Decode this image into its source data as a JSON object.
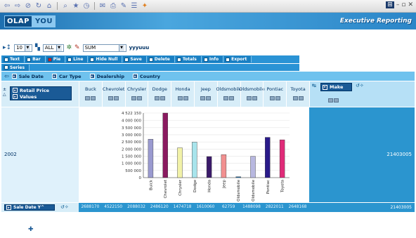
{
  "app": {
    "logo_left": "OLAP",
    "logo_right": "YOU",
    "header_title": "Executive Reporting"
  },
  "controls": {
    "topn_value": "10",
    "filter_value": "ALL",
    "function_value": "SUM",
    "period_label": "yyyuuu"
  },
  "toolbar": [
    {
      "label": "Text",
      "color": "white"
    },
    {
      "label": "Bar",
      "color": "white"
    },
    {
      "label": "Pie",
      "color": "red"
    },
    {
      "label": "Line",
      "color": "white"
    },
    {
      "label": "Hide Null",
      "color": "white"
    },
    {
      "label": "Save",
      "color": "white"
    },
    {
      "label": "Delete",
      "color": "white"
    },
    {
      "label": "Totals",
      "color": "white"
    },
    {
      "label": "Info",
      "color": "white"
    },
    {
      "label": "Export",
      "color": "white"
    }
  ],
  "series_label": "Series",
  "filters": [
    "Sale Date",
    "Car Type",
    "Dealership",
    "Country"
  ],
  "measures": [
    "Retail Price",
    "Values"
  ],
  "columns": [
    "Buck",
    "Chevrolet",
    "Chrysler",
    "Dodge",
    "Honda",
    "Jeep",
    "Oldsmobile",
    "Oldsmobile",
    "Pontiac",
    "Toyota"
  ],
  "make_label": "Make",
  "row_label": "2002",
  "row_total": "21403005",
  "footer_label": "Sale Date Y^",
  "footer_values": [
    "2688170",
    "4522150",
    "2088032",
    "2486120",
    "1474718",
    "1610060",
    "62759",
    "1488098",
    "2822011",
    "2648168"
  ],
  "footer_total": "21403005",
  "colors": {
    "bar_colors": [
      "#9a9ad0",
      "#8a1a60",
      "#f2f2a8",
      "#a8e4ec",
      "#3a1a6a",
      "#f29090",
      "#1a6aa8",
      "#b8b8e0",
      "#2a1a8a",
      "#e02a78"
    ]
  },
  "chart_data": {
    "type": "bar",
    "categories": [
      "Buick",
      "Chevrolet",
      "Chrysler",
      "Dodge",
      "Honda",
      "Jeep",
      "Oldsmobile",
      "Oldsmobile",
      "Pontiac",
      "Toyota"
    ],
    "values": [
      2688170,
      4522150,
      2088032,
      2486120,
      1474718,
      1610060,
      62759,
      1488098,
      2822011,
      2648168
    ],
    "y_ticks": [
      "4 522 150",
      "4 000 000",
      "3 500 000",
      "3 000 000",
      "2 500 000",
      "2 000 000",
      "1 500 000",
      "1 000 000",
      "500 000",
      "0"
    ],
    "ylim": [
      0,
      4522150
    ],
    "grid": true
  }
}
